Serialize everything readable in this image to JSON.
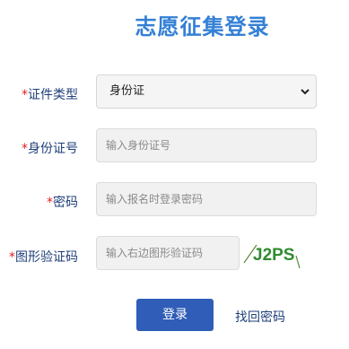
{
  "title": "志愿征集登录",
  "form": {
    "required_mark": "*",
    "id_type": {
      "label": "证件类型",
      "selected": "身份证"
    },
    "id_number": {
      "label": "身份证号",
      "placeholder": "输入身份证号"
    },
    "password": {
      "label": "密码",
      "placeholder": "输入报名时登录密码"
    },
    "captcha": {
      "label": "图形验证码",
      "placeholder": "输入右边图形验证码",
      "image_text": "J2PS"
    }
  },
  "actions": {
    "login_label": "登录",
    "forgot_label": "找回密码"
  },
  "colors": {
    "title": "#3480d6",
    "label": "#1f3f7a",
    "required": "#e02020",
    "button": "#2f5db7",
    "captcha_text": "#2e8b2e"
  }
}
